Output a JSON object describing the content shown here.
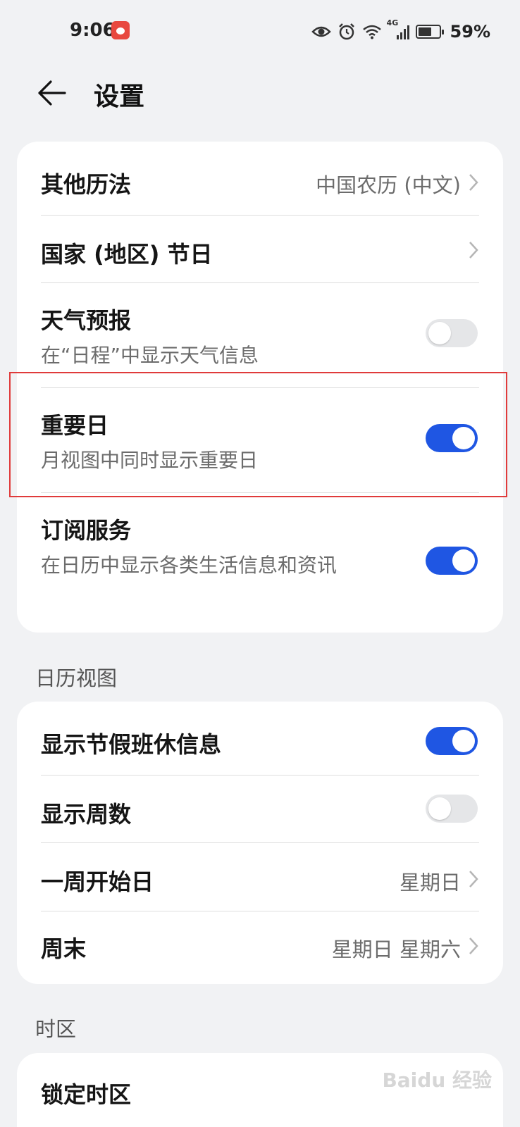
{
  "status_bar": {
    "time": "9:06",
    "network": "4G",
    "battery_percent": "59%"
  },
  "header": {
    "title": "设置"
  },
  "card1": {
    "other_calendar": {
      "title": "其他历法",
      "value": "中国农历 (中文)"
    },
    "holidays": {
      "title": "国家 (地区) 节日"
    },
    "weather": {
      "title": "天气预报",
      "subtitle": "在“日程”中显示天气信息",
      "enabled": false
    },
    "important_days": {
      "title": "重要日",
      "subtitle": "月视图中同时显示重要日",
      "enabled": true
    },
    "subscription": {
      "title": "订阅服务",
      "subtitle": "在日历中显示各类生活信息和资讯",
      "enabled": true
    }
  },
  "section_calendar_view": {
    "header": "日历视图",
    "show_holiday_info": {
      "title": "显示节假班休信息",
      "enabled": true
    },
    "show_week_numbers": {
      "title": "显示周数",
      "enabled": false
    },
    "week_start": {
      "title": "一周开始日",
      "value": "星期日"
    },
    "weekend": {
      "title": "周末",
      "value": "星期日 星期六"
    }
  },
  "section_timezone": {
    "header": "时区",
    "lock_timezone": {
      "title": "锁定时区"
    }
  },
  "watermark": "Baidu 经验",
  "colors": {
    "accent": "#1f56e3",
    "highlight_border": "#e03b3b",
    "background": "#f1f2f4"
  }
}
